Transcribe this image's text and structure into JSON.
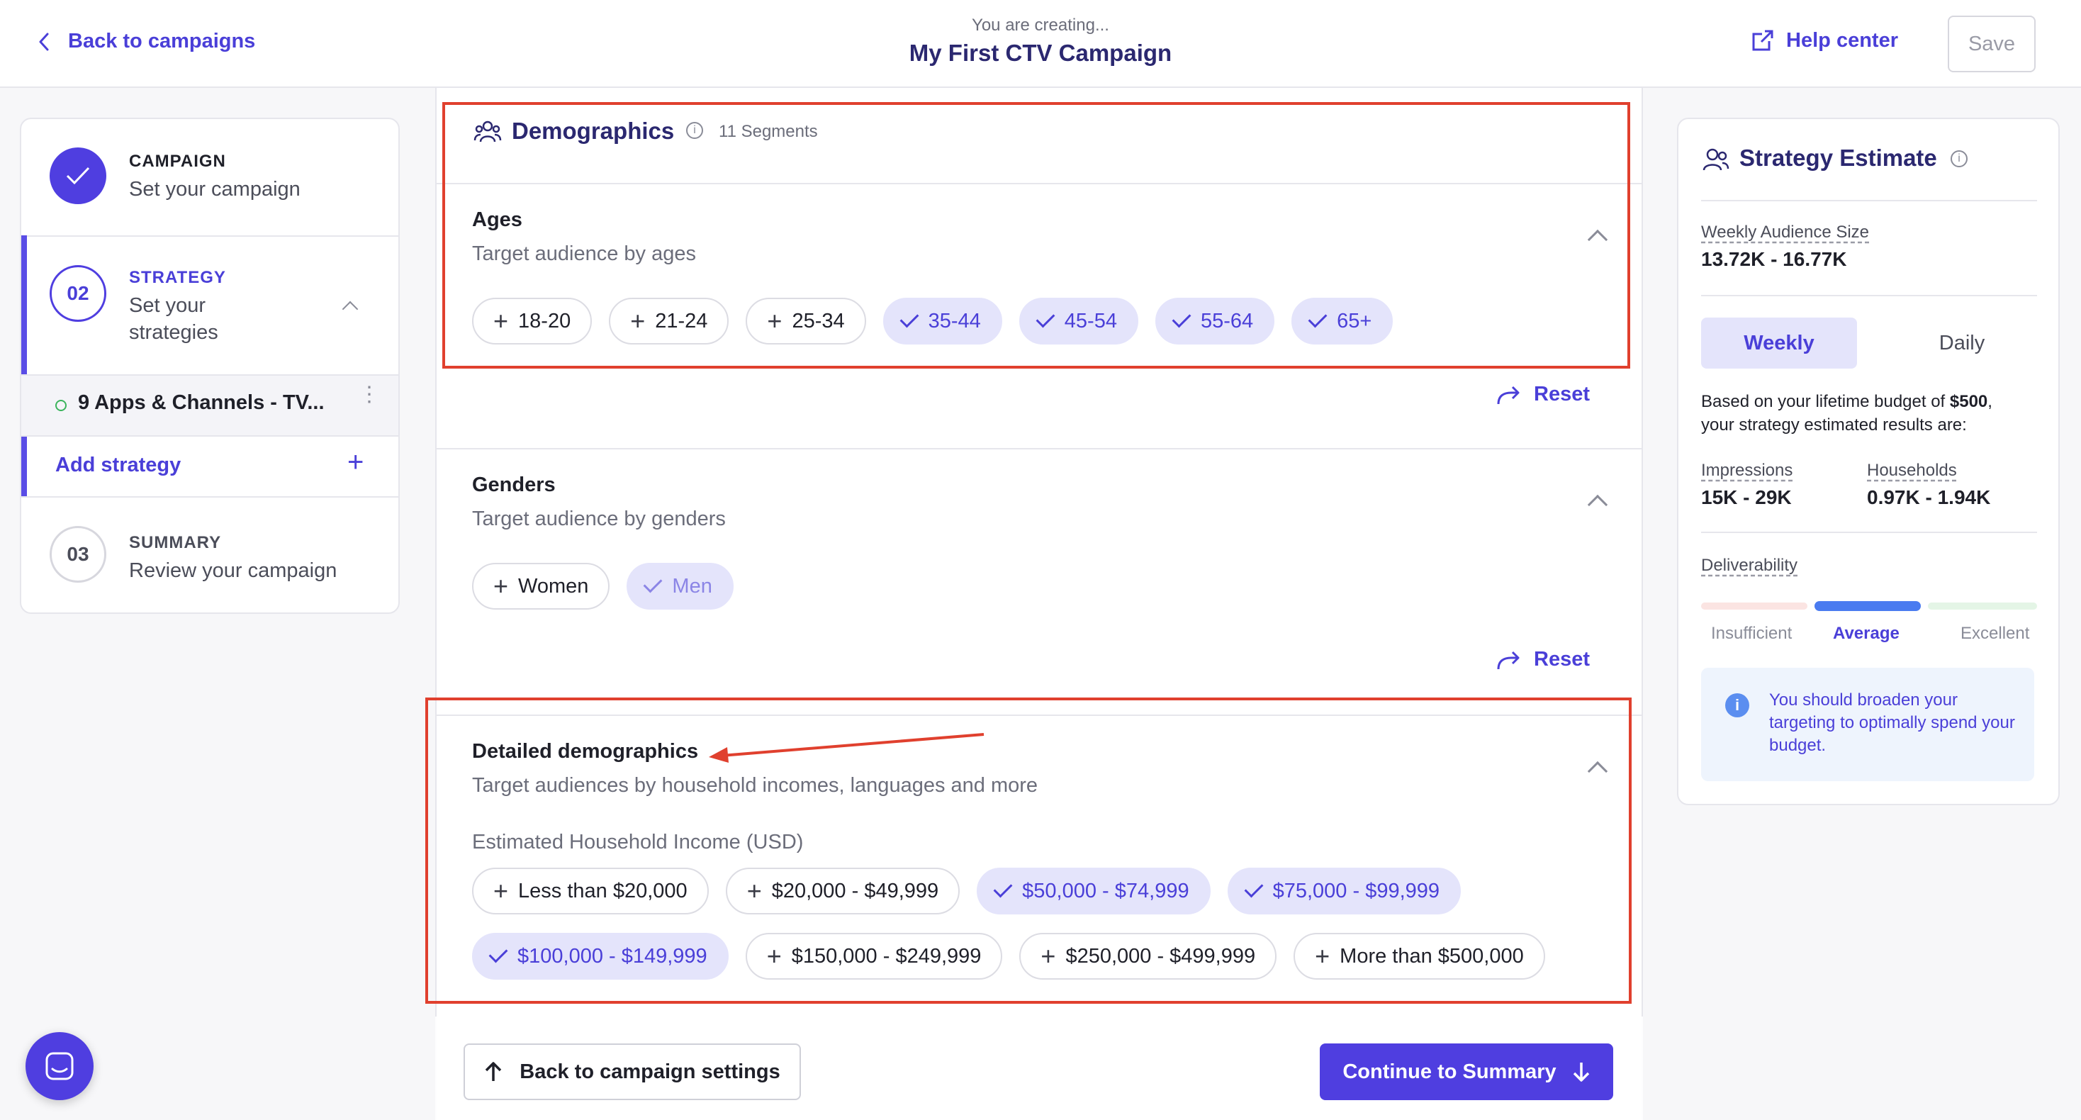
{
  "header": {
    "back_label": "Back to campaigns",
    "creating_label": "You are creating...",
    "campaign_title": "My First CTV Campaign",
    "help_label": "Help center",
    "save_label": "Save"
  },
  "stepper": {
    "campaign": {
      "label": "CAMPAIGN",
      "desc": "Set your campaign"
    },
    "strategy": {
      "number": "02",
      "label": "STRATEGY",
      "desc_line1": "Set your",
      "desc_line2": "strategies"
    },
    "strategy_item": "9 Apps & Channels - TV...",
    "add_strategy": "Add strategy",
    "summary": {
      "number": "03",
      "label": "SUMMARY",
      "desc": "Review your campaign"
    }
  },
  "demographics": {
    "title": "Demographics",
    "segments": "11 Segments"
  },
  "ages": {
    "title": "Ages",
    "subtitle": "Target audience by ages",
    "options": [
      {
        "label": "18-20",
        "selected": false
      },
      {
        "label": "21-24",
        "selected": false
      },
      {
        "label": "25-34",
        "selected": false
      },
      {
        "label": "35-44",
        "selected": true
      },
      {
        "label": "45-54",
        "selected": true
      },
      {
        "label": "55-64",
        "selected": true
      },
      {
        "label": "65+",
        "selected": true
      }
    ],
    "reset": "Reset"
  },
  "genders": {
    "title": "Genders",
    "subtitle": "Target audience by genders",
    "options": [
      {
        "label": "Women",
        "selected": false
      },
      {
        "label": "Men",
        "selected": true
      }
    ],
    "reset": "Reset"
  },
  "detailed": {
    "title": "Detailed demographics",
    "subtitle": "Target audiences by household incomes, languages and more",
    "income_label": "Estimated Household Income (USD)",
    "row1": [
      {
        "label": "Less than $20,000",
        "selected": false
      },
      {
        "label": "$20,000 - $49,999",
        "selected": false
      },
      {
        "label": "$50,000 - $74,999",
        "selected": true
      },
      {
        "label": "$75,000 - $99,999",
        "selected": true
      }
    ],
    "row2": [
      {
        "label": "$100,000 - $149,999",
        "selected": true
      },
      {
        "label": "$150,000 - $249,999",
        "selected": false
      },
      {
        "label": "$250,000 - $499,999",
        "selected": false
      },
      {
        "label": "More than $500,000",
        "selected": false
      }
    ]
  },
  "footer": {
    "back_label": "Back to campaign settings",
    "continue_label": "Continue to Summary"
  },
  "estimate": {
    "title": "Strategy Estimate",
    "weekly_audience_label": "Weekly Audience Size",
    "weekly_audience_value": "13.72K - 16.77K",
    "tab_weekly": "Weekly",
    "tab_daily": "Daily",
    "budget_note_prefix": "Based on your lifetime budget of ",
    "budget_amount": "$500",
    "budget_note_suffix": ",",
    "budget_note_line2": "your strategy estimated results are:",
    "impressions_label": "Impressions",
    "impressions_value": "15K - 29K",
    "households_label": "Households",
    "households_value": "0.97K - 1.94K",
    "deliverability_label": "Deliverability",
    "deliv_levels": [
      "Insufficient",
      "Average",
      "Excellent"
    ],
    "deliv_selected": "Average",
    "info_text": "You should broaden your targeting to optimally spend your budget.",
    "colors": {
      "accent": "#4f3ee0",
      "insufficient": "#fbe4e2",
      "average": "#4a7bf0",
      "excellent": "#e4f5e6"
    }
  }
}
